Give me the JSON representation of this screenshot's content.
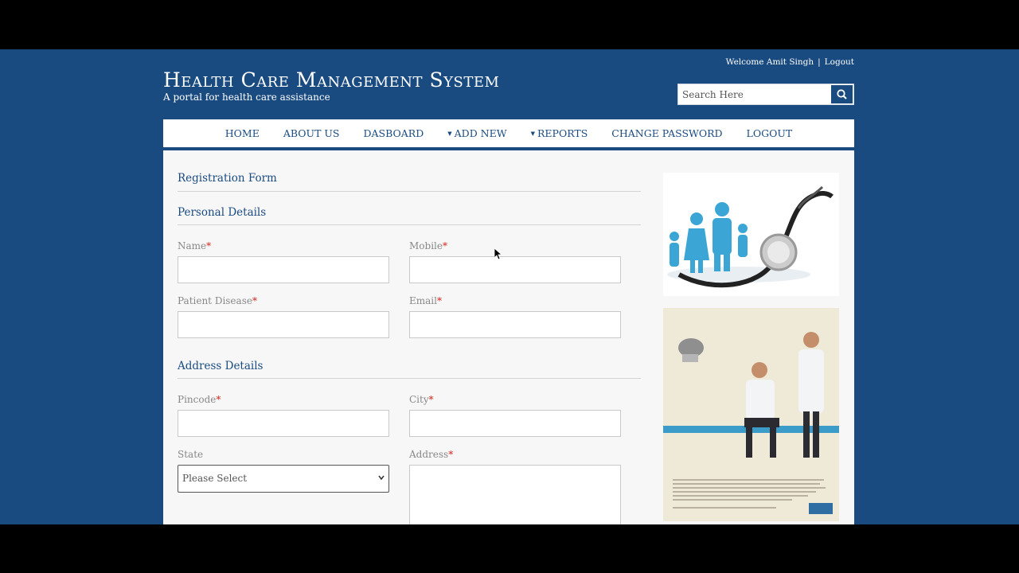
{
  "header": {
    "title": "Health Care Management System",
    "subtitle": "A portal for health care assistance",
    "welcome": "Welcome Amit Singh",
    "separator": "|",
    "logout_link": "Logout",
    "search_placeholder": "Search Here"
  },
  "nav": {
    "items": [
      {
        "label": "HOME"
      },
      {
        "label": "ABOUT US"
      },
      {
        "label": "DASBOARD"
      },
      {
        "label": "ADD NEW"
      },
      {
        "label": "REPORTS"
      },
      {
        "label": "CHANGE PASSWORD"
      },
      {
        "label": "LOGOUT"
      }
    ]
  },
  "form": {
    "title": "Registration Form",
    "personal_title": "Personal Details",
    "address_title": "Address Details",
    "required_mark": "*",
    "fields": {
      "name": {
        "label": "Name",
        "value": ""
      },
      "mobile": {
        "label": "Mobile",
        "value": ""
      },
      "disease": {
        "label": "Patient Disease",
        "value": ""
      },
      "email": {
        "label": "Email",
        "value": ""
      },
      "pincode": {
        "label": "Pincode",
        "value": ""
      },
      "city": {
        "label": "City",
        "value": ""
      },
      "state": {
        "label": "State",
        "selected": "Please Select"
      },
      "address": {
        "label": "Address",
        "value": ""
      }
    }
  },
  "colors": {
    "brand": "#1a4b80",
    "required": "#d9241c",
    "panel": "#f7f7f7"
  },
  "icons": [
    "search-icon",
    "caret-down-icon",
    "chevron-down-icon",
    "mouse-cursor-icon"
  ]
}
